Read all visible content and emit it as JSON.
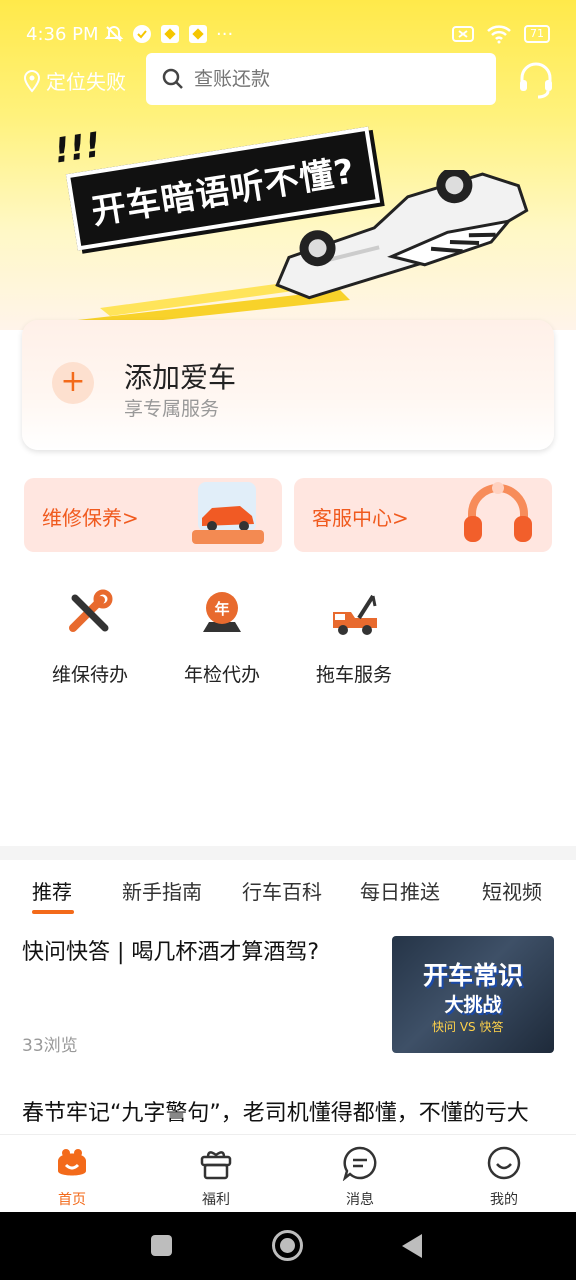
{
  "status_bar": {
    "time": "4:36 PM",
    "left_icons": [
      "mute-icon",
      "check-badge-icon",
      "app-icon",
      "app-icon",
      "more-dots-icon"
    ],
    "battery": "71"
  },
  "header": {
    "location_label": "定位失败",
    "search_placeholder": "查账还款",
    "banner_bang": "!!!",
    "banner_slogan": "开车暗语听不懂?"
  },
  "add_car": {
    "title": "添加爱车",
    "subtitle": "享专属服务",
    "plus": "+"
  },
  "service_cards": [
    {
      "label": "维修保养>",
      "icon": "car-showcase-icon"
    },
    {
      "label": "客服中心>",
      "icon": "headset-icon"
    }
  ],
  "quick_entries": [
    {
      "label": "维保待办",
      "icon": "wrench-screwdriver-icon"
    },
    {
      "label": "年检代办",
      "icon": "annual-inspection-icon",
      "badge": "年"
    },
    {
      "label": "拖车服务",
      "icon": "tow-truck-icon"
    }
  ],
  "tabs": [
    "推荐",
    "新手指南",
    "行车百科",
    "每日推送",
    "短视频"
  ],
  "active_tab": 0,
  "articles": [
    {
      "title": "快问快答 | 喝几杯酒才算酒驾?",
      "views": "33浏览",
      "thumb_main": "开车常识",
      "thumb_sub": "大挑战",
      "thumb_vs": "快问 VS 快答"
    },
    {
      "title": "春节牢记“九字警句”，老司机懂得都懂，不懂的亏大了!"
    }
  ],
  "bottom_nav": [
    {
      "label": "首页",
      "icon": "home-icon"
    },
    {
      "label": "福利",
      "icon": "gift-icon"
    },
    {
      "label": "消息",
      "icon": "message-icon"
    },
    {
      "label": "我的",
      "icon": "profile-icon"
    }
  ],
  "colors": {
    "accent": "#f36a1a",
    "banner_yellow": "#ffe94a",
    "card_pink": "#ffe6e0"
  }
}
